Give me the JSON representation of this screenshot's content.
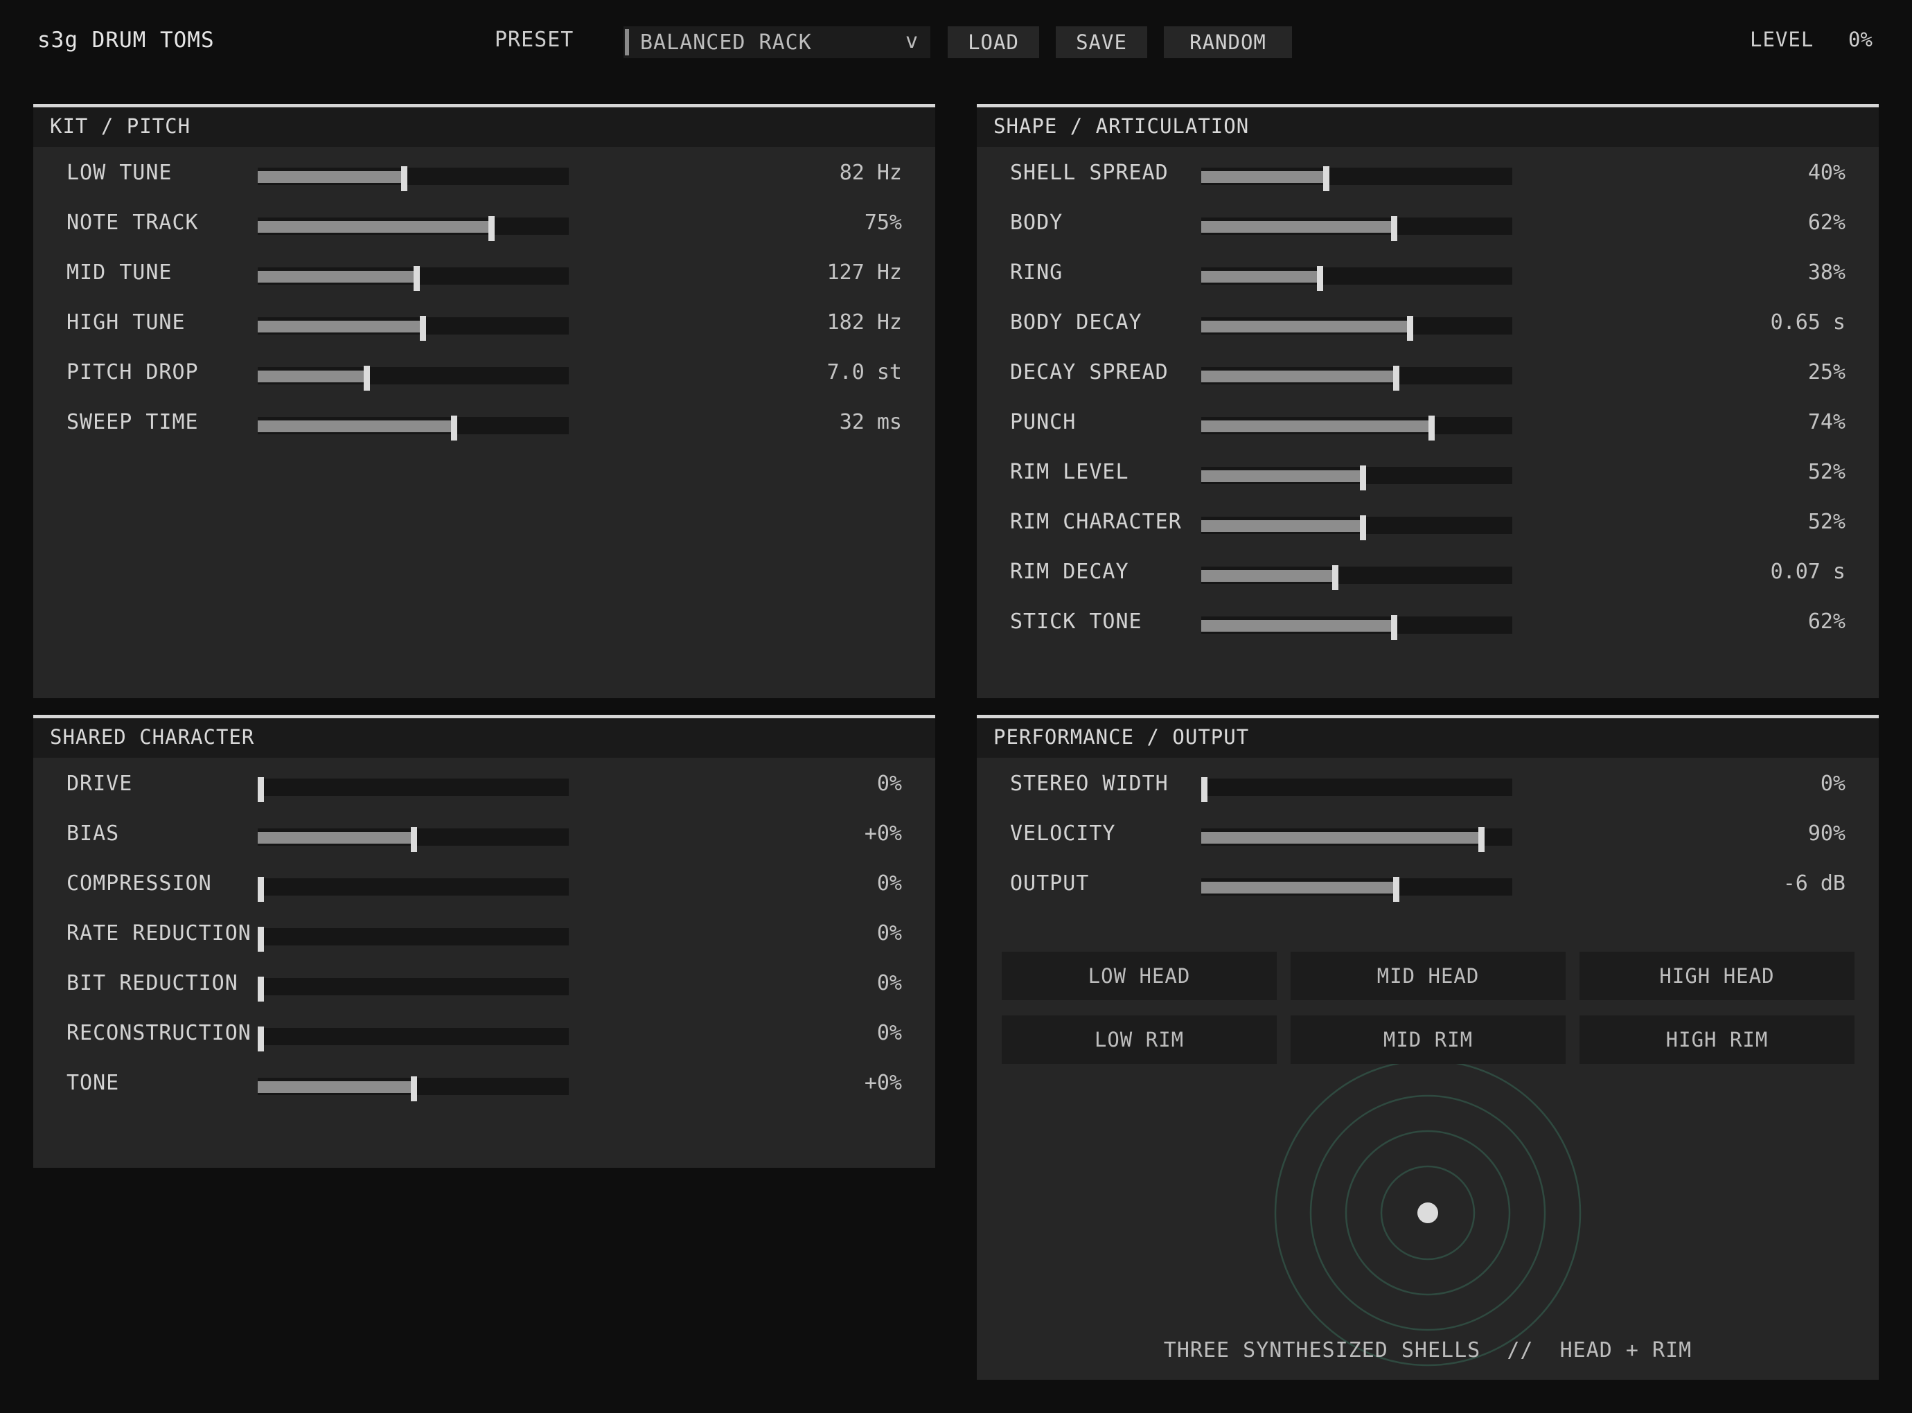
{
  "header": {
    "title": "s3g DRUM TOMS",
    "preset_label": "PRESET",
    "preset_value": "BALANCED RACK",
    "preset_arrow": "v",
    "load_label": "LOAD",
    "save_label": "SAVE",
    "random_label": "RANDOM",
    "level_label": "LEVEL",
    "level_value": "0%"
  },
  "panels": {
    "kit": {
      "title": "KIT / PITCH",
      "rows": [
        {
          "label": "LOW TUNE",
          "value": "82 Hz",
          "level": 0.47
        },
        {
          "label": "NOTE TRACK",
          "value": "75%",
          "level": 0.75
        },
        {
          "label": "MID TUNE",
          "value": "127 Hz",
          "level": 0.51
        },
        {
          "label": "HIGH TUNE",
          "value": "182 Hz",
          "level": 0.53
        },
        {
          "label": "PITCH DROP",
          "value": "7.0 st",
          "level": 0.35
        },
        {
          "label": "SWEEP TIME",
          "value": "32 ms",
          "level": 0.63
        }
      ]
    },
    "shape": {
      "title": "SHAPE / ARTICULATION",
      "rows": [
        {
          "label": "SHELL SPREAD",
          "value": "40%",
          "level": 0.4
        },
        {
          "label": "BODY",
          "value": "62%",
          "level": 0.62
        },
        {
          "label": "RING",
          "value": "38%",
          "level": 0.38
        },
        {
          "label": "BODY DECAY",
          "value": "0.65 s",
          "level": 0.67
        },
        {
          "label": "DECAY SPREAD",
          "value": "25%",
          "level": 0.625
        },
        {
          "label": "PUNCH",
          "value": "74%",
          "level": 0.74
        },
        {
          "label": "RIM LEVEL",
          "value": "52%",
          "level": 0.52
        },
        {
          "label": "RIM CHARACTER",
          "value": "52%",
          "level": 0.52
        },
        {
          "label": "RIM DECAY",
          "value": "0.07 s",
          "level": 0.43
        },
        {
          "label": "STICK TONE",
          "value": "62%",
          "level": 0.62
        }
      ]
    },
    "shared": {
      "title": "SHARED CHARACTER",
      "rows": [
        {
          "label": "DRIVE",
          "value": "0%",
          "level": 0.0
        },
        {
          "label": "BIAS",
          "value": "+0%",
          "level": 0.5
        },
        {
          "label": "COMPRESSION",
          "value": "0%",
          "level": 0.0
        },
        {
          "label": "RATE REDUCTION",
          "value": "0%",
          "level": 0.0
        },
        {
          "label": "BIT REDUCTION",
          "value": "0%",
          "level": 0.0
        },
        {
          "label": "RECONSTRUCTION",
          "value": "0%",
          "level": 0.0
        },
        {
          "label": "TONE",
          "value": "+0%",
          "level": 0.5
        }
      ]
    },
    "perf": {
      "title": "PERFORMANCE / OUTPUT",
      "rows": [
        {
          "label": "STEREO WIDTH",
          "value": "0%",
          "level": 0.0
        },
        {
          "label": "VELOCITY",
          "value": "90%",
          "level": 0.9
        },
        {
          "label": "OUTPUT",
          "value": "-6 dB",
          "level": 0.625
        }
      ],
      "pads": [
        "LOW HEAD",
        "MID HEAD",
        "HIGH HEAD",
        "LOW RIM",
        "MID RIM",
        "HIGH RIM"
      ],
      "footer": "THREE SYNTHESIZED SHELLS  //  HEAD + RIM"
    }
  },
  "colors": {
    "background": "#0e0e0e",
    "panel": "#262626",
    "panel_header": "#1a1a1a",
    "fill": "#8d8d8d",
    "thumb": "#dcdcdc",
    "drum_ring": "#2f4a40"
  }
}
